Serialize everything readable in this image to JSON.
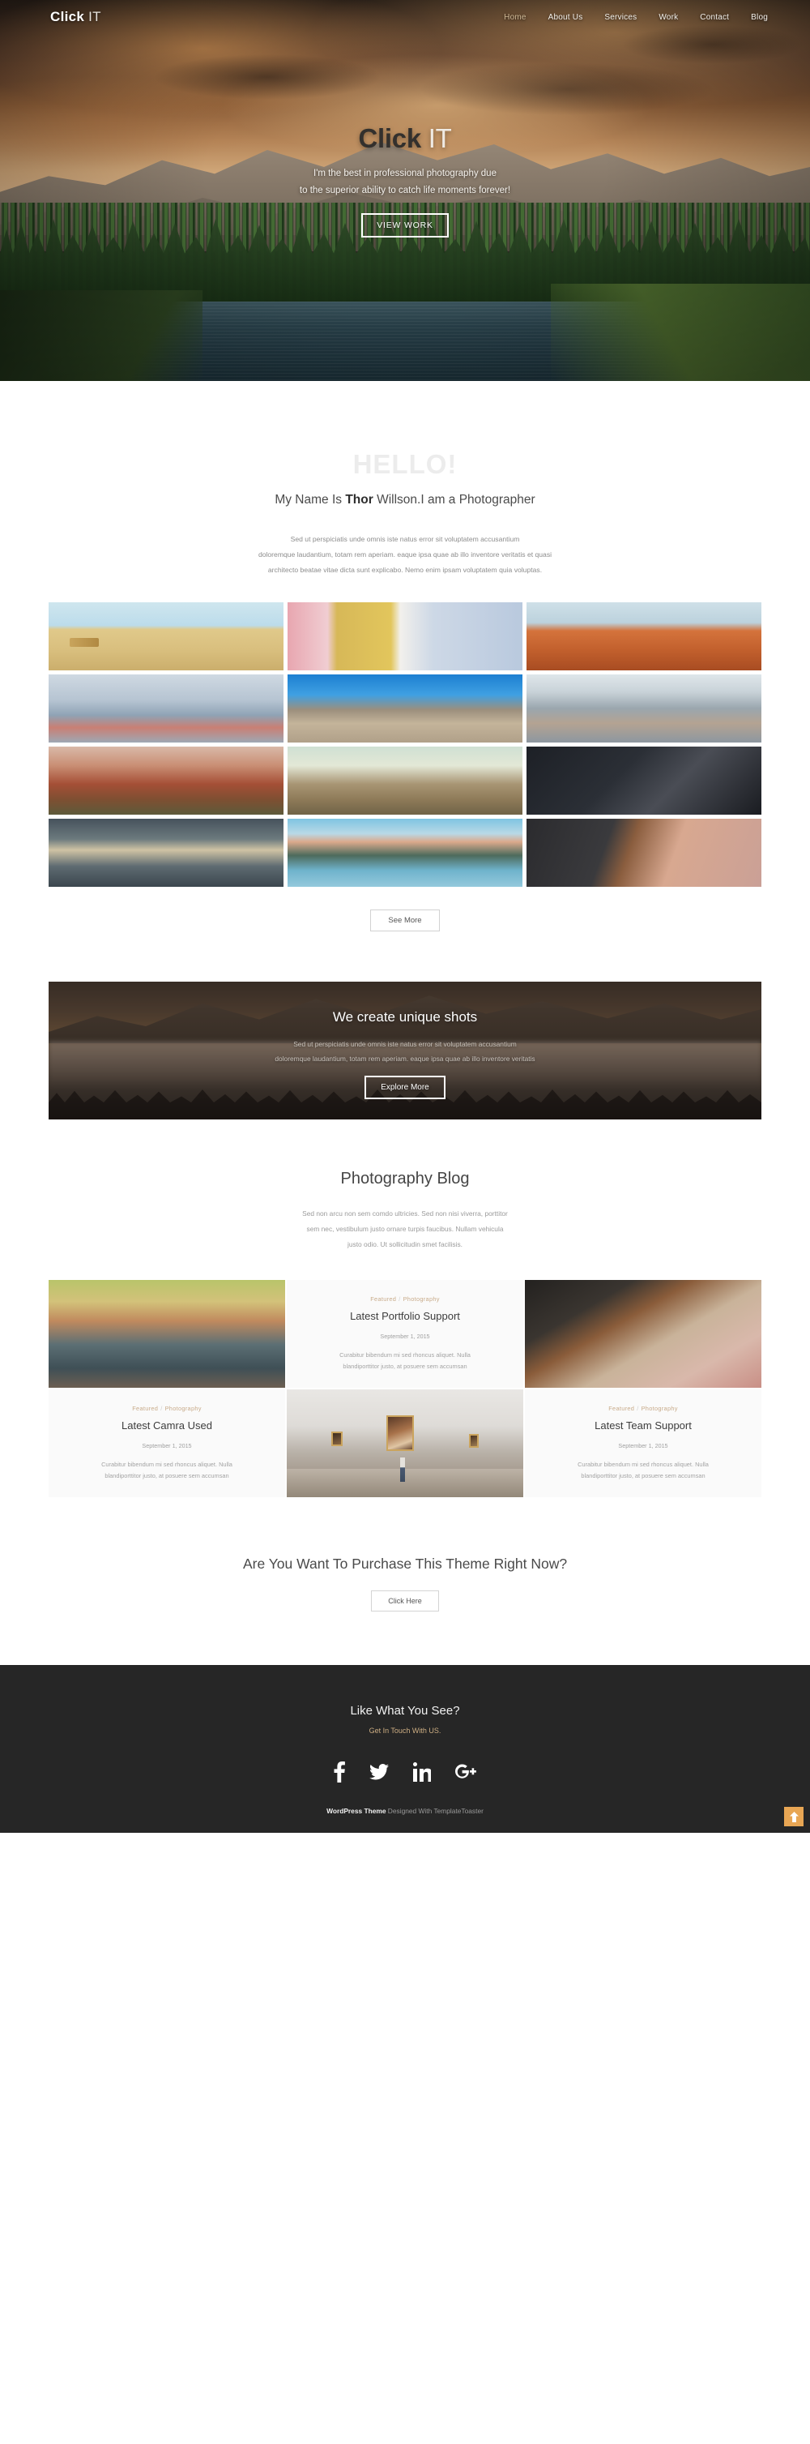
{
  "nav": {
    "logo_bold": "Click",
    "logo_light": " IT",
    "items": [
      {
        "label": "Home",
        "active": true
      },
      {
        "label": "About Us",
        "active": false
      },
      {
        "label": "Services",
        "active": false
      },
      {
        "label": "Work",
        "active": false
      },
      {
        "label": "Contact",
        "active": false
      },
      {
        "label": "Blog",
        "active": false
      }
    ]
  },
  "hero": {
    "title_bold": "Click",
    "title_light": " IT",
    "sub_line1": "I'm the best in professional photography due",
    "sub_line2": "to the superior ability to catch life moments forever!",
    "button": "VIEW WORK"
  },
  "about": {
    "hello": "HELLO!",
    "name_pre": "My Name Is ",
    "name_bold": "Thor",
    "name_post": " Willson.I am a Photographer",
    "paragraph_line1": "Sed ut perspiciatis unde omnis iste natus error sit voluptatem accusantium",
    "paragraph_line2": "doloremque laudantium, totam rem aperiam. eaque ipsa quae ab illo inventore veritatis et quasi",
    "paragraph_line3": "architecto beatae vitae dicta sunt explicabo. Nemo enim ipsam voluptatem quia voluptas."
  },
  "gallery": {
    "items": [
      {
        "name": "hay-bales-tractor-wheat-field"
      },
      {
        "name": "hands-forming-heart-denim"
      },
      {
        "name": "person-on-red-rock-canyon"
      },
      {
        "name": "color-run-festival-runners"
      },
      {
        "name": "three-people-sitting-on-cliff"
      },
      {
        "name": "backpacker-walking-busy-street"
      },
      {
        "name": "autumn-forest-red-leaves"
      },
      {
        "name": "person-jumping-on-mountain"
      },
      {
        "name": "fashion-model-fur-collar"
      },
      {
        "name": "sunset-over-mountain-lake"
      },
      {
        "name": "man-facing-reflective-lake"
      },
      {
        "name": "photographer-holding-camera-suit"
      }
    ],
    "see_more": "See More"
  },
  "parallax": {
    "title": "We create unique shots",
    "p_line1": "Sed ut perspiciatis unde omnis iste natus error sit voluptatem accusantium",
    "p_line2": "doloremque laudantium, totam rem aperiam. eaque ipsa quae ab illo inventore veritatis",
    "button": "Explore More"
  },
  "blog": {
    "title": "Photography Blog",
    "sub_line1": "Sed non arcu non sem comdo ultricies. Sed non nisi viverra, porttitor",
    "sub_line2": "sem nec, vestibulum justo ornare turpis faucibus. Nullam vehicula",
    "sub_line3": "justo odio. Ut sollicitudin smet facilisis.",
    "posts": [
      {
        "category_a": "Featured",
        "category_b": "Photography",
        "heading": "Latest Portfolio Support",
        "date": "September 1, 2015",
        "body_line1": "Curabitur bibendum mi sed rhoncus aliquet. Nulla",
        "body_line2": "blandiporttitor justo, at posuere sem accumsan"
      },
      {
        "category_a": "Featured",
        "category_b": "Photography",
        "heading": "Latest Camra Used",
        "date": "September 1, 2015",
        "body_line1": "Curabitur bibendum mi sed rhoncus aliquet. Nulla",
        "body_line2": "blandiporttitor justo, at posuere sem accumsan"
      },
      {
        "category_a": "Featured",
        "category_b": "Photography",
        "heading": "Latest Team Support",
        "date": "September 1, 2015",
        "body_line1": "Curabitur bibendum mi sed rhoncus aliquet. Nulla",
        "body_line2": "blandiporttitor justo, at posuere sem accumsan"
      }
    ],
    "images": [
      {
        "name": "child-on-shoulders-street-crowd"
      },
      {
        "name": "man-in-suit-holding-camera"
      },
      {
        "name": "woman-viewing-paintings-in-gallery"
      }
    ],
    "separator": "/"
  },
  "cta": {
    "title": "Are You Want To Purchase This Theme Right Now?",
    "button": "Click Here"
  },
  "footer": {
    "title": "Like What You See?",
    "subtitle": "Get In Touch With US.",
    "socials": [
      {
        "name": "facebook-icon"
      },
      {
        "name": "twitter-icon"
      },
      {
        "name": "linkedin-icon"
      },
      {
        "name": "googleplus-icon"
      }
    ],
    "credit_bold": "WordPress Theme",
    "credit_rest": " Designed With TemplateToaster"
  },
  "colors": {
    "accent": "#cdae83",
    "scroll_top_bg": "#e8a654",
    "footer_bg": "#262626"
  }
}
